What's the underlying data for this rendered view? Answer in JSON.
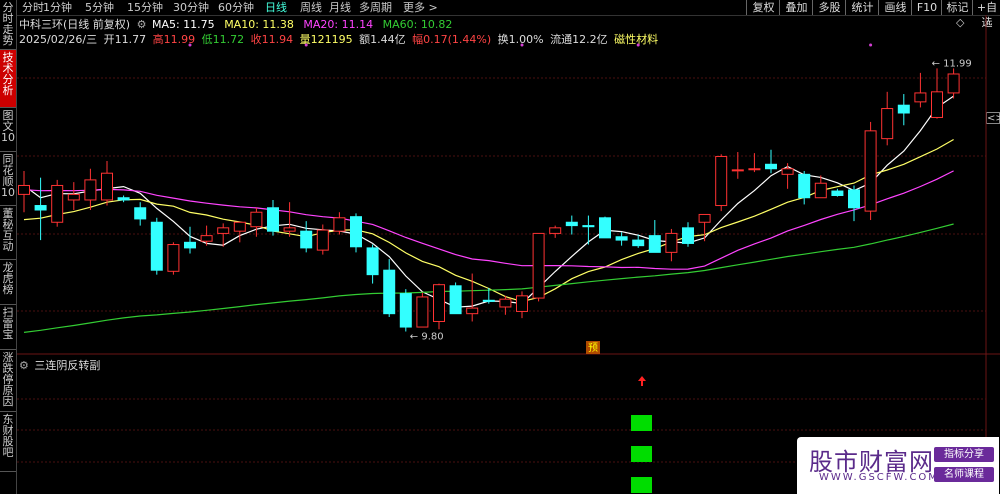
{
  "left_tabs": [
    {
      "label": "分时走势",
      "active": false
    },
    {
      "label": "技术分析",
      "active": true
    },
    {
      "label": "图文10",
      "active": false
    },
    {
      "label": "同花顺10",
      "active": false
    },
    {
      "label": "董秘互动",
      "active": false
    },
    {
      "label": "龙虎榜",
      "active": false
    },
    {
      "label": "扫雷宝",
      "active": false
    },
    {
      "label": "涨跌停原因",
      "active": false
    },
    {
      "label": "东财股吧",
      "active": false
    }
  ],
  "toolbar": {
    "periods": [
      "分时",
      "1分钟",
      "5分钟",
      "15分钟",
      "30分钟",
      "60分钟",
      "日线",
      "周线",
      "月线",
      "多周期",
      "更多 >"
    ],
    "active_period": "日线",
    "buttons": [
      "复权",
      "叠加",
      "多股",
      "统计",
      "画线",
      "F10",
      "标记",
      "+自选"
    ],
    "diamond_icon": "◇",
    "chevron_icon": "<>"
  },
  "header": {
    "title": "中科三环(日线 前复权)",
    "ma_label_color": "#ccc",
    "ma5": "MA5: 11.75",
    "ma10": "MA10: 11.38",
    "ma20": "MA20: 11.14",
    "ma60": "MA60: 10.82",
    "date": "2025/02/26/三",
    "open": "开11.77",
    "high": "高11.99",
    "low": "低11.72",
    "close": "收11.94",
    "volume": "量121195",
    "amount": "额1.44亿",
    "change": "幅0.17(1.44%)",
    "turnover": "换1.00%",
    "float": "流通12.2亿",
    "concept": "磁性材料"
  },
  "annotations": {
    "high_label": "11.99",
    "low_label": "9.80",
    "pre_marker": "预"
  },
  "sub_panel": {
    "title": "三连阴反转副"
  },
  "watermark": {
    "main": "股市财富网",
    "sub": "WWW.GSCFW.COM",
    "badge1": "指标分享",
    "badge2": "名师课程"
  },
  "colors": {
    "up": "#ff3333",
    "down": "#33ffff",
    "ma5": "#ffffff",
    "ma10": "#ffff66",
    "ma20": "#ff44ff",
    "ma60": "#33cc33",
    "signal": "#00dd00",
    "arrow": "#ff2222"
  },
  "chart_data": {
    "type": "candlestick",
    "price_range": [
      9.5,
      12.2
    ],
    "candles": [
      {
        "o": 10.86,
        "h": 11.07,
        "l": 10.7,
        "c": 10.94
      },
      {
        "o": 10.76,
        "h": 11.01,
        "l": 10.45,
        "c": 10.72
      },
      {
        "o": 10.61,
        "h": 10.99,
        "l": 10.57,
        "c": 10.94
      },
      {
        "o": 10.81,
        "h": 10.97,
        "l": 10.72,
        "c": 10.86
      },
      {
        "o": 10.81,
        "h": 11.09,
        "l": 10.72,
        "c": 10.99
      },
      {
        "o": 10.81,
        "h": 11.16,
        "l": 10.76,
        "c": 11.05
      },
      {
        "o": 10.83,
        "h": 10.85,
        "l": 10.79,
        "c": 10.81
      },
      {
        "o": 10.74,
        "h": 10.79,
        "l": 10.58,
        "c": 10.64
      },
      {
        "o": 10.61,
        "h": 10.65,
        "l": 10.14,
        "c": 10.18
      },
      {
        "o": 10.17,
        "h": 10.43,
        "l": 10.14,
        "c": 10.41
      },
      {
        "o": 10.43,
        "h": 10.57,
        "l": 10.33,
        "c": 10.38
      },
      {
        "o": 10.44,
        "h": 10.58,
        "l": 10.4,
        "c": 10.49
      },
      {
        "o": 10.51,
        "h": 10.6,
        "l": 10.39,
        "c": 10.56
      },
      {
        "o": 10.53,
        "h": 10.61,
        "l": 10.43,
        "c": 10.61
      },
      {
        "o": 10.57,
        "h": 10.74,
        "l": 10.48,
        "c": 10.7
      },
      {
        "o": 10.74,
        "h": 10.81,
        "l": 10.49,
        "c": 10.53
      },
      {
        "o": 10.53,
        "h": 10.79,
        "l": 10.48,
        "c": 10.56
      },
      {
        "o": 10.53,
        "h": 10.62,
        "l": 10.34,
        "c": 10.38
      },
      {
        "o": 10.36,
        "h": 10.59,
        "l": 10.32,
        "c": 10.54
      },
      {
        "o": 10.53,
        "h": 10.7,
        "l": 10.5,
        "c": 10.65
      },
      {
        "o": 10.66,
        "h": 10.69,
        "l": 10.34,
        "c": 10.39
      },
      {
        "o": 10.38,
        "h": 10.41,
        "l": 10.06,
        "c": 10.14
      },
      {
        "o": 10.18,
        "h": 10.28,
        "l": 9.76,
        "c": 9.79
      },
      {
        "o": 9.97,
        "h": 10.01,
        "l": 9.63,
        "c": 9.67
      },
      {
        "o": 9.67,
        "h": 9.98,
        "l": 9.67,
        "c": 9.94
      },
      {
        "o": 9.72,
        "h": 10.06,
        "l": 9.65,
        "c": 10.05
      },
      {
        "o": 10.04,
        "h": 10.07,
        "l": 9.79,
        "c": 9.79
      },
      {
        "o": 9.79,
        "h": 10.15,
        "l": 9.72,
        "c": 9.84
      },
      {
        "o": 9.91,
        "h": 10.02,
        "l": 9.88,
        "c": 9.9
      },
      {
        "o": 9.85,
        "h": 9.95,
        "l": 9.78,
        "c": 9.92
      },
      {
        "o": 9.81,
        "h": 9.99,
        "l": 9.75,
        "c": 9.95
      },
      {
        "o": 9.93,
        "h": 10.1,
        "l": 9.9,
        "c": 10.51
      },
      {
        "o": 10.51,
        "h": 10.58,
        "l": 10.47,
        "c": 10.56
      },
      {
        "o": 10.61,
        "h": 10.67,
        "l": 10.5,
        "c": 10.58
      },
      {
        "o": 10.58,
        "h": 10.67,
        "l": 10.41,
        "c": 10.57
      },
      {
        "o": 10.65,
        "h": 10.66,
        "l": 10.47,
        "c": 10.47
      },
      {
        "o": 10.48,
        "h": 10.52,
        "l": 10.4,
        "c": 10.45
      },
      {
        "o": 10.45,
        "h": 10.5,
        "l": 10.38,
        "c": 10.4
      },
      {
        "o": 10.49,
        "h": 10.63,
        "l": 10.46,
        "c": 10.34
      },
      {
        "o": 10.34,
        "h": 10.55,
        "l": 10.26,
        "c": 10.51
      },
      {
        "o": 10.56,
        "h": 10.61,
        "l": 10.39,
        "c": 10.42
      },
      {
        "o": 10.61,
        "h": 10.67,
        "l": 10.44,
        "c": 10.68
      },
      {
        "o": 10.76,
        "h": 11.22,
        "l": 10.71,
        "c": 11.2
      },
      {
        "o": 11.08,
        "h": 11.24,
        "l": 11.0,
        "c": 11.08
      },
      {
        "o": 11.09,
        "h": 11.23,
        "l": 11.06,
        "c": 11.09
      },
      {
        "o": 11.13,
        "h": 11.26,
        "l": 11.05,
        "c": 11.09
      },
      {
        "o": 11.04,
        "h": 11.14,
        "l": 10.91,
        "c": 11.09
      },
      {
        "o": 11.04,
        "h": 11.07,
        "l": 10.77,
        "c": 10.83
      },
      {
        "o": 10.83,
        "h": 11.03,
        "l": 10.83,
        "c": 10.96
      },
      {
        "o": 10.89,
        "h": 10.91,
        "l": 10.84,
        "c": 10.85
      },
      {
        "o": 10.9,
        "h": 10.94,
        "l": 10.62,
        "c": 10.74
      },
      {
        "o": 10.71,
        "h": 11.51,
        "l": 10.63,
        "c": 11.43
      },
      {
        "o": 11.36,
        "h": 11.78,
        "l": 11.3,
        "c": 11.63
      },
      {
        "o": 11.66,
        "h": 11.76,
        "l": 11.48,
        "c": 11.59
      },
      {
        "o": 11.69,
        "h": 11.95,
        "l": 11.64,
        "c": 11.77
      },
      {
        "o": 11.55,
        "h": 11.99,
        "l": 11.54,
        "c": 11.78
      },
      {
        "o": 11.77,
        "h": 11.99,
        "l": 11.72,
        "c": 11.94
      }
    ],
    "signal_blocks_at": [
      38
    ],
    "arrow_at": 38
  }
}
